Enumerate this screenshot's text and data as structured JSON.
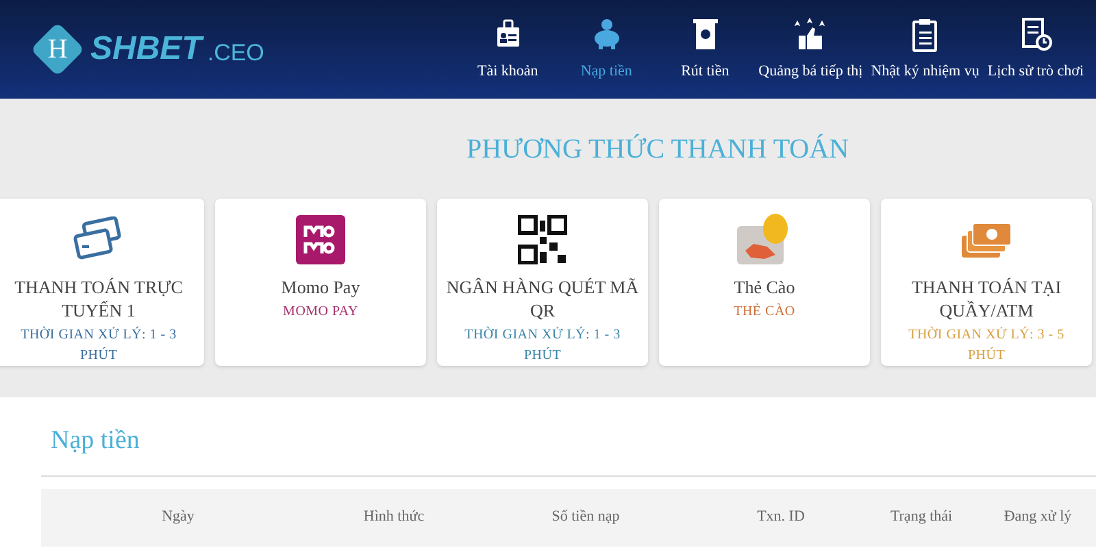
{
  "header": {
    "logo": {
      "mark": "H",
      "name": "SHBET",
      "suffix": ".CEO"
    },
    "nav": [
      {
        "kind": "account",
        "label": "Tài khoản",
        "selected": false
      },
      {
        "kind": "piggy",
        "label": "Nạp tiền",
        "selected": true
      },
      {
        "kind": "atm",
        "label": "Rút tiền",
        "selected": false
      },
      {
        "kind": "thumbs",
        "label": "Quảng bá tiếp thị",
        "selected": false
      },
      {
        "kind": "clipboard",
        "label": "Nhật ký nhiệm vụ",
        "selected": false
      },
      {
        "kind": "history",
        "label": "Lịch sử trò chơi",
        "selected": false
      }
    ]
  },
  "title": "PHƯƠNG THỨC THANH TOÁN",
  "methods": [
    {
      "kind": "cards",
      "name": "THANH TOÁN TRỰC TUYẾN 1",
      "note": "THỜI GIAN XỬ LÝ: 1 - 3 PHÚT",
      "color": "#3a6fa0"
    },
    {
      "kind": "momo",
      "name": "Momo Pay",
      "note": "MOMO PAY",
      "color": "#a8326e"
    },
    {
      "kind": "qr",
      "name": "NGÂN HÀNG QUÉT MÃ QR",
      "note": "THỜI GIAN XỬ LÝ: 1 - 3 PHÚT",
      "color": "#3a85a8"
    },
    {
      "kind": "scratch",
      "name": "Thẻ Cào",
      "note": "THẺ CÀO",
      "color": "#d0703a"
    },
    {
      "kind": "cash",
      "name": "THANH TOÁN TẠI QUẦY/ATM",
      "note": "THỜI GIAN XỬ LÝ: 3 - 5 PHÚT",
      "color": "#d9a040"
    }
  ],
  "deposit": {
    "title": "Nạp tiền",
    "columns": [
      "Ngày",
      "Hình thức",
      "Số tiền nạp",
      "Txn. ID",
      "Trạng thái",
      "Đang xử lý"
    ]
  }
}
